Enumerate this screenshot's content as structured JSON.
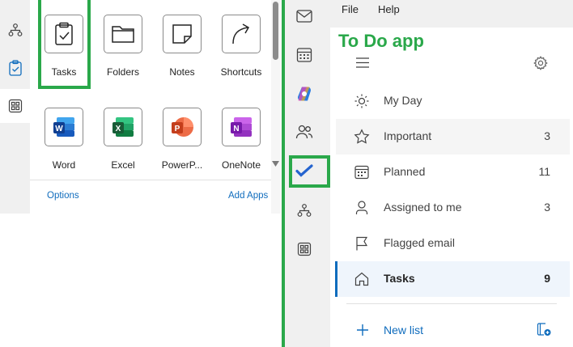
{
  "left_panel": {
    "rail": [
      "org-chart-icon",
      "tasks-icon",
      "more-apps-icon"
    ],
    "apps": [
      {
        "label": "Tasks",
        "icon": "tasks-clipboard-icon"
      },
      {
        "label": "Folders",
        "icon": "folder-icon"
      },
      {
        "label": "Notes",
        "icon": "note-icon"
      },
      {
        "label": "Shortcuts",
        "icon": "shortcut-arrow-icon"
      },
      {
        "label": "Word",
        "icon": "word-icon"
      },
      {
        "label": "Excel",
        "icon": "excel-icon"
      },
      {
        "label": "PowerP...",
        "icon": "powerpoint-icon"
      },
      {
        "label": "OneNote",
        "icon": "onenote-icon"
      }
    ],
    "options_label": "Options",
    "add_apps_label": "Add Apps"
  },
  "outlook_rail": [
    "mail-icon",
    "calendar-icon",
    "copilot-icon",
    "people-icon",
    "todo-check-icon",
    "org-chart-icon",
    "more-apps-icon"
  ],
  "menu": {
    "file": "File",
    "help": "Help"
  },
  "annotation": "To Do app",
  "todo": {
    "lists": [
      {
        "label": "My Day",
        "count": "",
        "icon": "sun-icon"
      },
      {
        "label": "Important",
        "count": "3",
        "icon": "star-icon"
      },
      {
        "label": "Planned",
        "count": "11",
        "icon": "calendar-grid-icon"
      },
      {
        "label": "Assigned to me",
        "count": "3",
        "icon": "person-icon"
      },
      {
        "label": "Flagged email",
        "count": "",
        "icon": "flag-icon"
      },
      {
        "label": "Tasks",
        "count": "9",
        "icon": "home-icon"
      }
    ],
    "new_list_label": "New list"
  },
  "colors": {
    "highlight_green": "#2aa84a",
    "accent_blue": "#0f6cbd"
  }
}
